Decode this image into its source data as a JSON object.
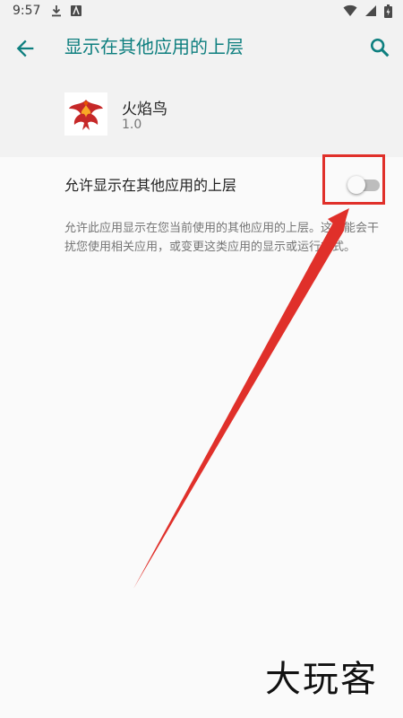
{
  "status_bar": {
    "time": "9:57",
    "left_icons": [
      "download-icon",
      "a-square-icon"
    ],
    "right_icons": [
      "wifi-icon",
      "signal-icon",
      "battery-icon"
    ]
  },
  "app_bar": {
    "title": "显示在其他应用的上层",
    "back_icon": "arrow-back-icon",
    "search_icon": "search-icon",
    "accent_color": "#0e7f7f"
  },
  "app_info": {
    "name": "火焰鸟",
    "version": "1.0",
    "icon": "phoenix-logo"
  },
  "setting": {
    "label": "允许显示在其他应用的上层",
    "enabled": false,
    "description": "允许此应用显示在您当前使用的其他应用的上层。这可能会干扰您使用相关应用，或变更这类应用的显示或运行方式。"
  },
  "annotation": {
    "color": "#e0302a"
  },
  "watermark": {
    "text": "大玩客"
  }
}
